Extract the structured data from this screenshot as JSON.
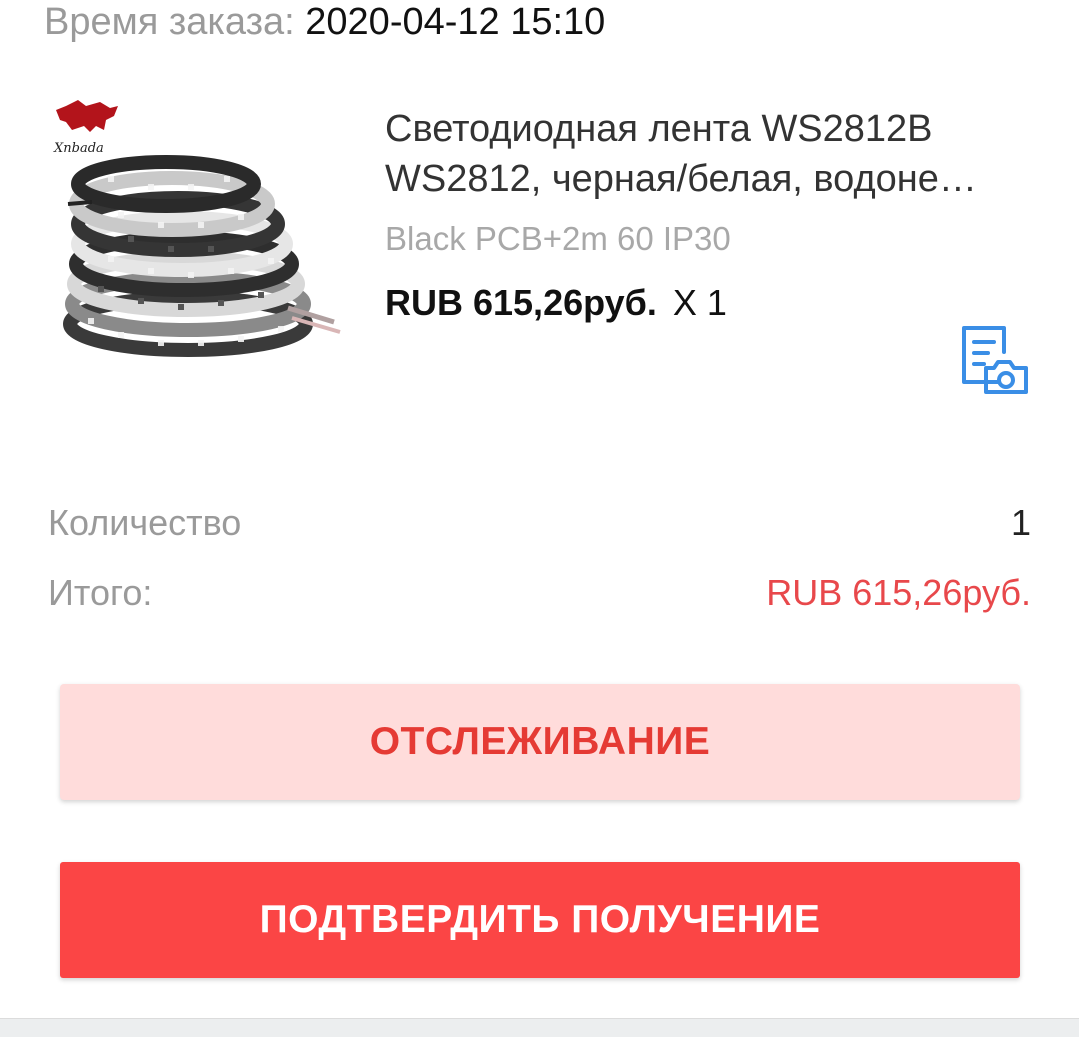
{
  "order": {
    "time_label": "Время заказа:",
    "time_value": "2020-04-12 15:10"
  },
  "product": {
    "brand_logo_text": "Xnbada",
    "title_line1": "Светодиодная лента WS2812B",
    "title_line2": "WS2812, черная/белая, водоне…",
    "variant": "Black PCB+2m 60 IP30",
    "price": "RUB 615,26руб.",
    "quantity_mark": "X 1",
    "review_icon": "document-camera-icon"
  },
  "summary": {
    "quantity_label": "Количество",
    "quantity_value": "1",
    "total_label": "Итого:",
    "total_value": "RUB 615,26руб."
  },
  "actions": {
    "track_label": "ОТСЛЕЖИВАНИЕ",
    "confirm_label": "ПОДТВЕРДИТЬ ПОЛУЧЕНИЕ"
  },
  "colors": {
    "accent_red": "#fb4545",
    "total_red": "#e8484b",
    "track_bg": "#ffdcdb",
    "icon_blue": "#3a8ee6"
  }
}
